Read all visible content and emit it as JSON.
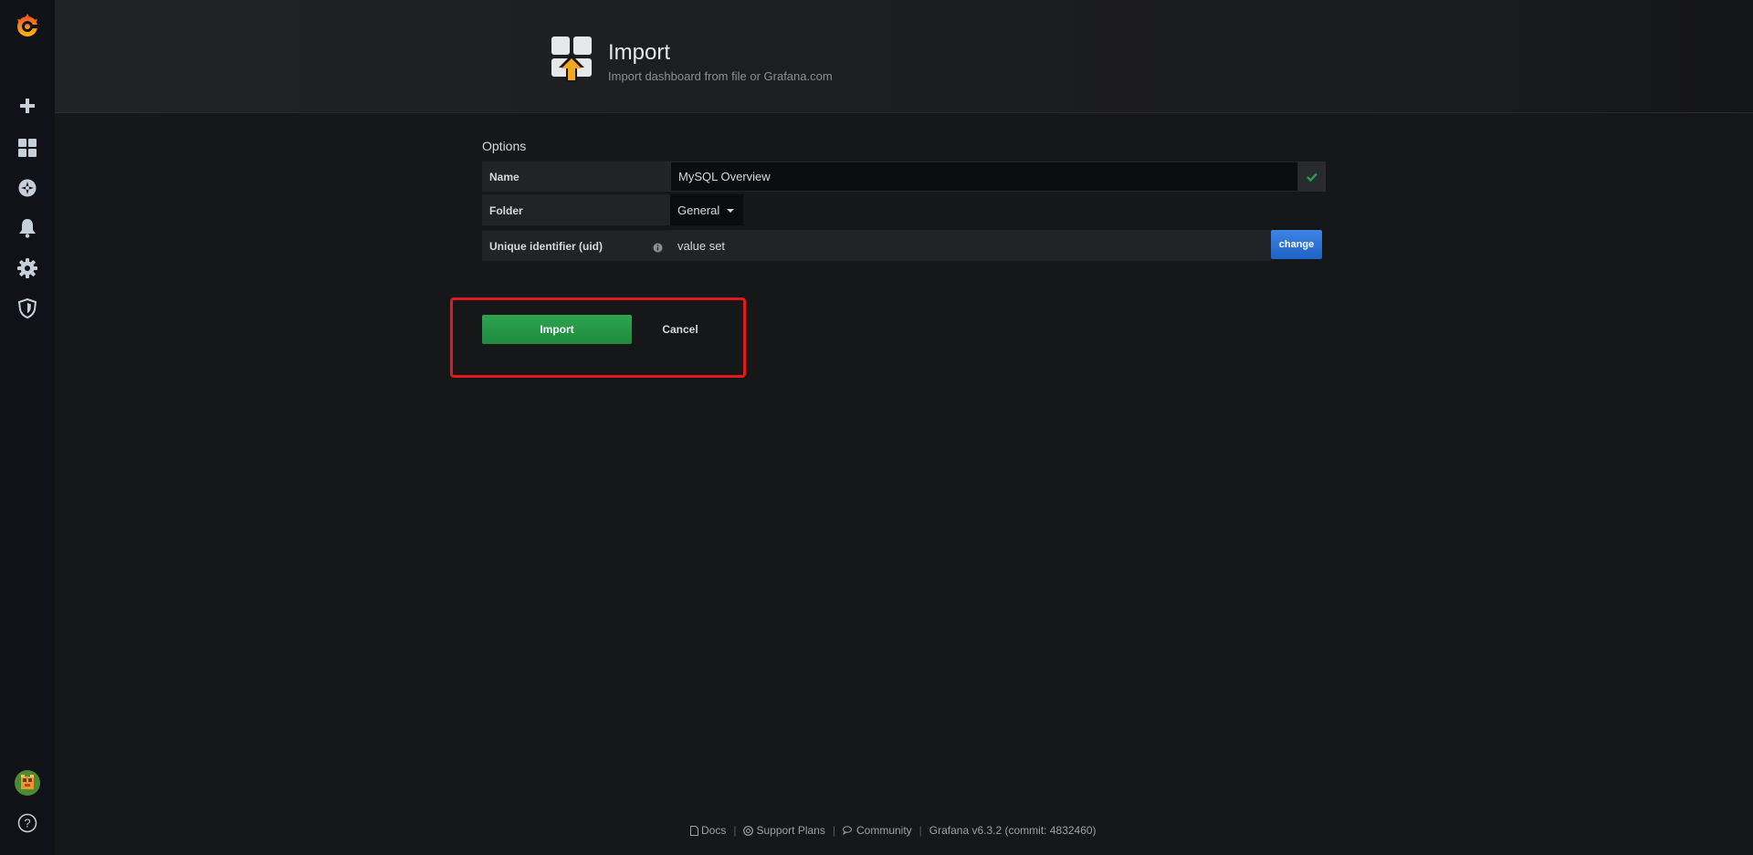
{
  "sidebar": {
    "items": [
      {
        "name": "create",
        "icon": "plus-icon"
      },
      {
        "name": "dashboards",
        "icon": "dashboards-grid-icon"
      },
      {
        "name": "explore",
        "icon": "explore-compass-icon"
      },
      {
        "name": "alerting",
        "icon": "bell-icon"
      },
      {
        "name": "configuration",
        "icon": "gear-icon"
      },
      {
        "name": "server-admin",
        "icon": "shield-icon"
      }
    ],
    "bottom": [
      {
        "name": "profile",
        "icon": "avatar"
      },
      {
        "name": "help",
        "icon": "question-icon"
      }
    ]
  },
  "header": {
    "title": "Import",
    "subtitle": "Import dashboard from file or Grafana.com"
  },
  "options": {
    "section_title": "Options",
    "name_label": "Name",
    "name_value": "MySQL Overview",
    "folder_label": "Folder",
    "folder_value": "General",
    "uid_label": "Unique identifier (uid)",
    "uid_value": "value set",
    "change_label": "change"
  },
  "actions": {
    "import_label": "Import",
    "cancel_label": "Cancel"
  },
  "footer": {
    "docs": "Docs",
    "support": "Support Plans",
    "community": "Community",
    "version": "Grafana v6.3.2 (commit: 4832460)"
  },
  "colors": {
    "background": "#161719",
    "sidebar": "#111217",
    "success": "#299c46",
    "primary": "#1f62c7",
    "highlight": "#e0191c",
    "brand": "#f58b1f"
  }
}
